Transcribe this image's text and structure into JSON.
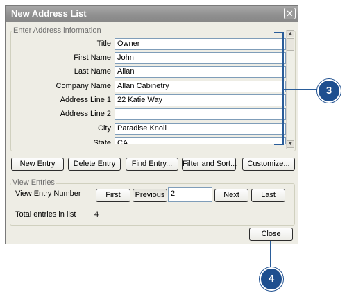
{
  "dialog": {
    "title": "New Address List",
    "close_glyph": "✕",
    "group_label": "Enter Address information",
    "fields": [
      {
        "label": "Title",
        "value": "Owner"
      },
      {
        "label": "First Name",
        "value": "John"
      },
      {
        "label": "Last Name",
        "value": "Allan"
      },
      {
        "label": "Company Name",
        "value": "Allan Cabinetry"
      },
      {
        "label": "Address Line 1",
        "value": "22 Katie Way"
      },
      {
        "label": "Address Line 2",
        "value": ""
      },
      {
        "label": "City",
        "value": "Paradise Knoll"
      },
      {
        "label": "State",
        "value": "CA"
      }
    ],
    "buttons": {
      "new_entry": "New Entry",
      "delete_entry": "Delete Entry",
      "find_entry": "Find Entry...",
      "filter_sort": "Filter and Sort...",
      "customize": "Customize..."
    },
    "view_entries": {
      "group_label": "View Entries",
      "number_label": "View Entry Number",
      "first": "First",
      "previous": "Previous",
      "entry_number": "2",
      "next": "Next",
      "last": "Last",
      "total_label": "Total entries in list",
      "total_value": "4"
    },
    "close_button": "Close"
  },
  "callouts": [
    {
      "number": "3",
      "color": "#1e4f8f"
    },
    {
      "number": "4",
      "color": "#1e4f8f"
    }
  ],
  "icons": {
    "scroll_up": "▲",
    "scroll_down": "▼"
  }
}
